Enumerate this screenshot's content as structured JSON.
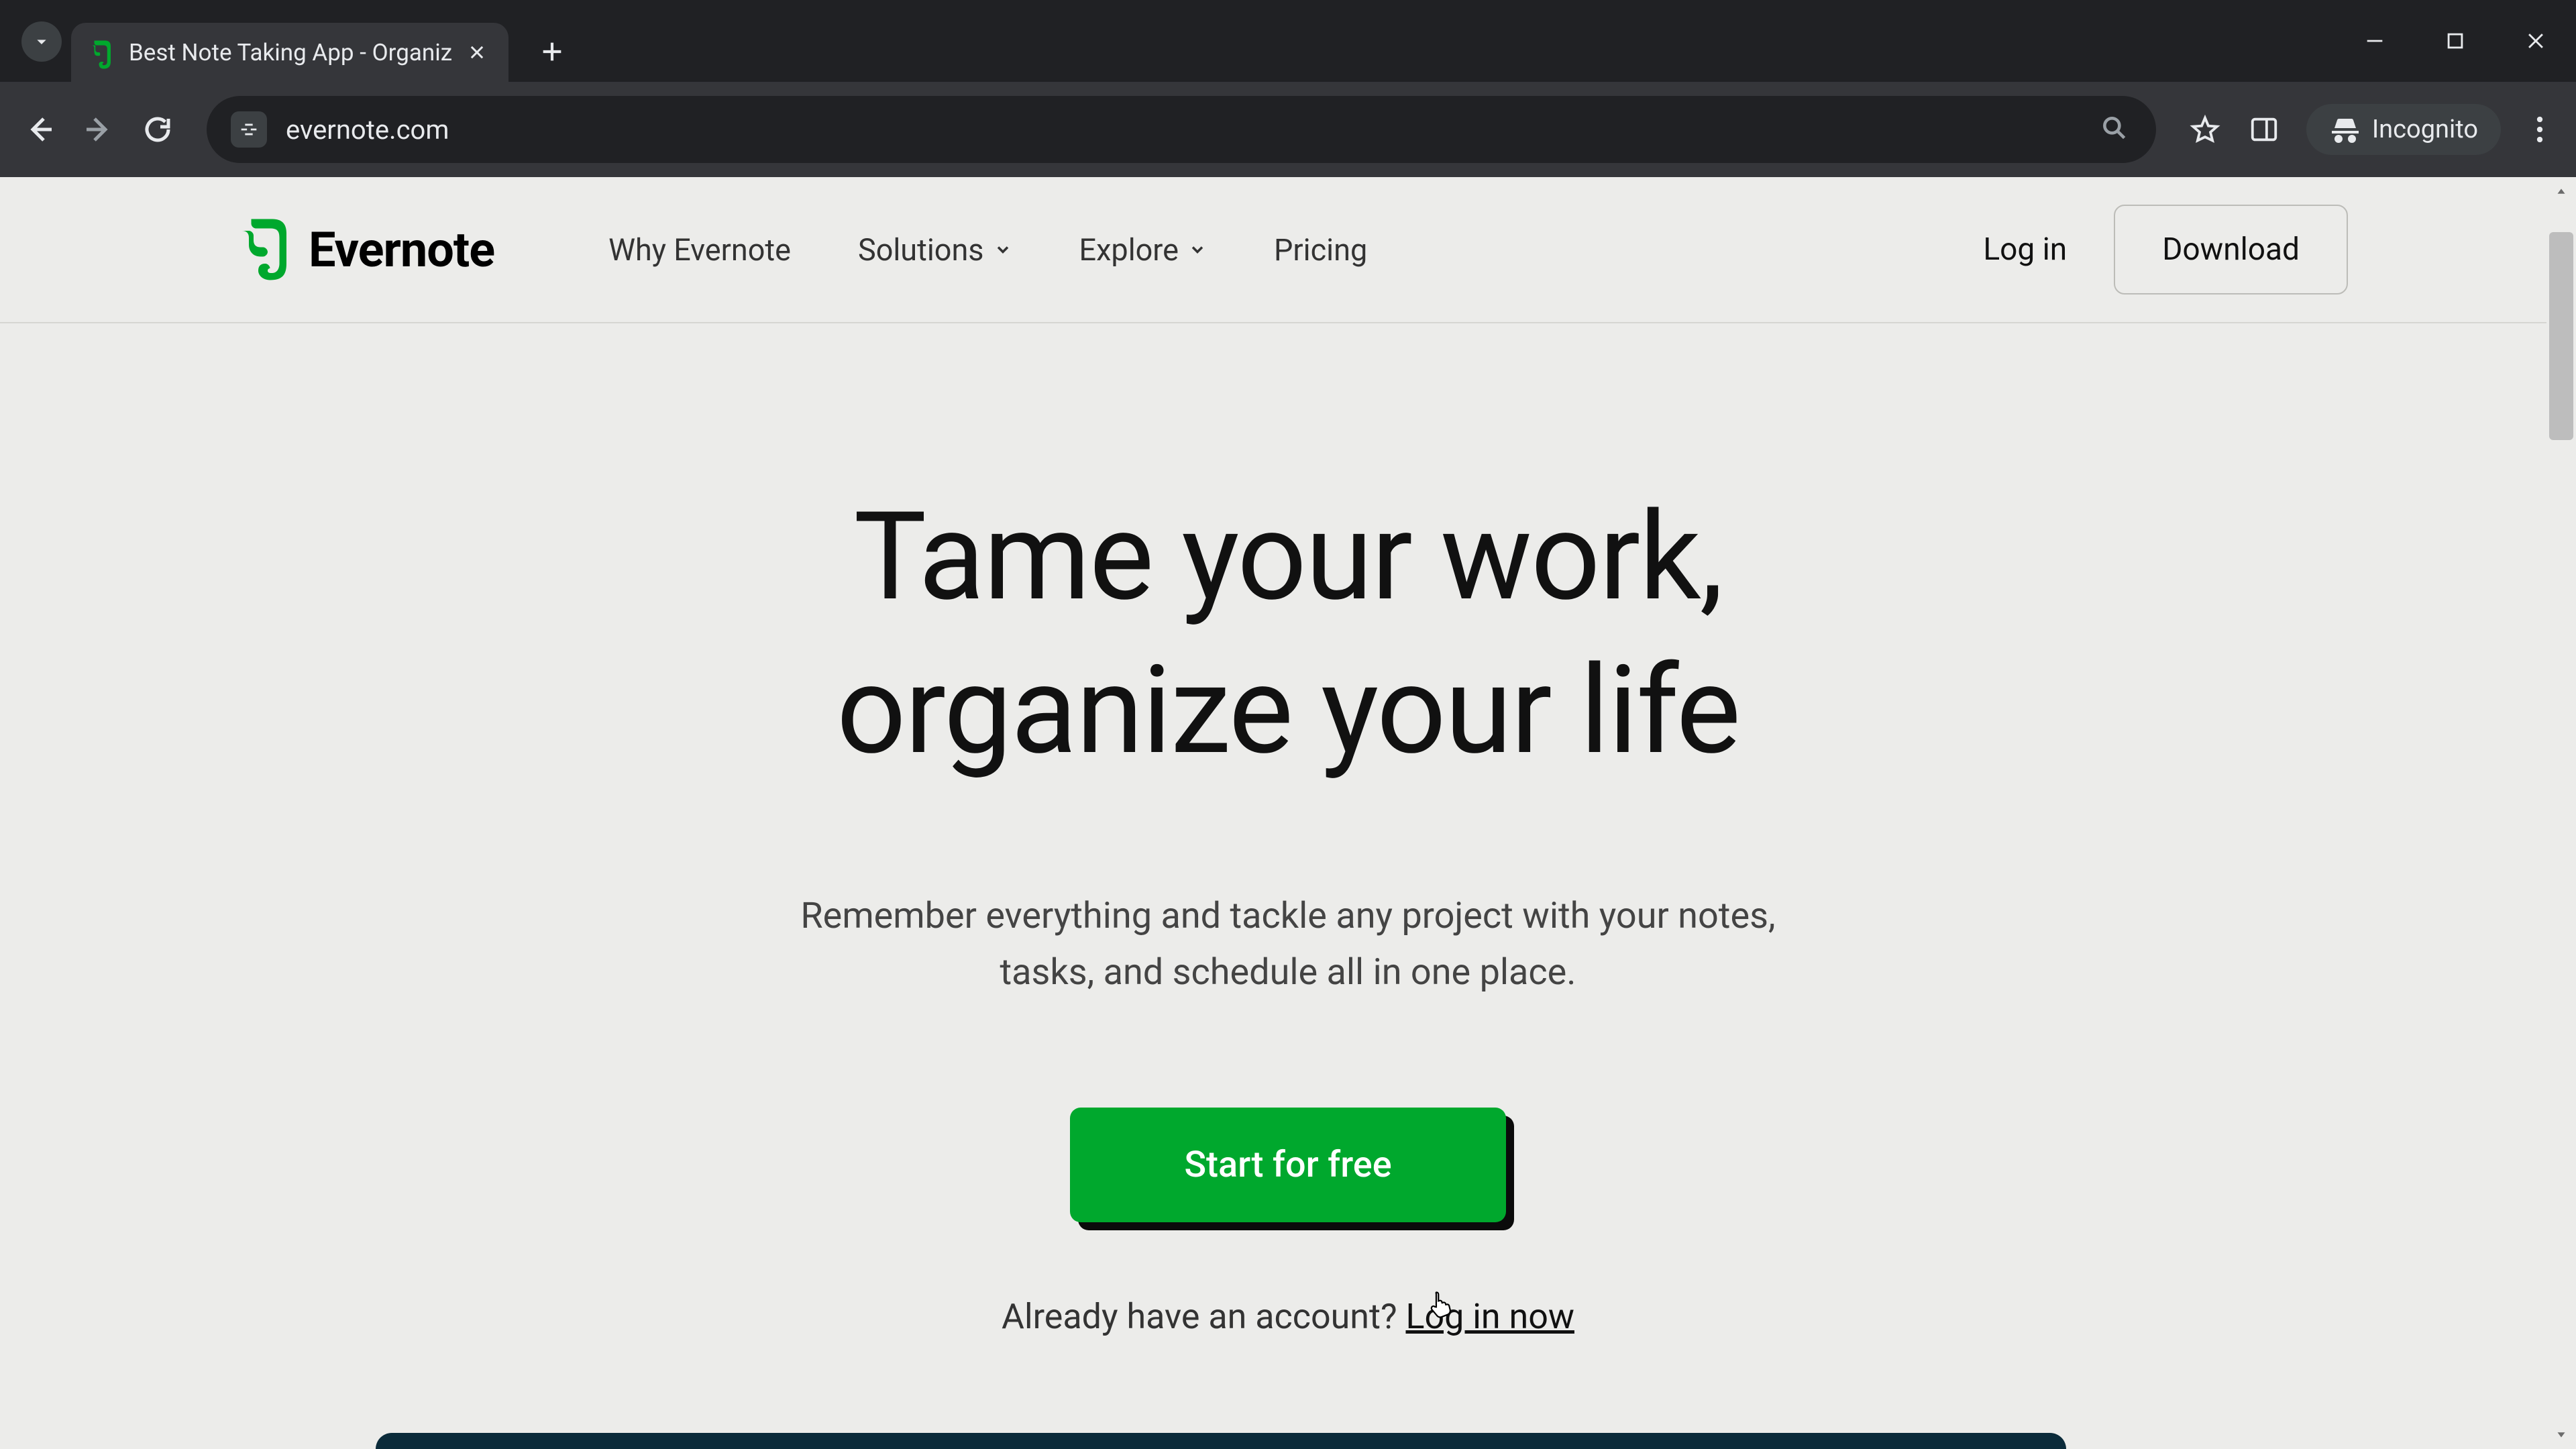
{
  "browser": {
    "tab_title": "Best Note Taking App - Organiz",
    "url": "evernote.com",
    "incognito_label": "Incognito"
  },
  "header": {
    "logo_text": "Evernote",
    "nav": {
      "why": "Why Evernote",
      "solutions": "Solutions",
      "explore": "Explore",
      "pricing": "Pricing"
    },
    "login": "Log in",
    "download": "Download"
  },
  "hero": {
    "line1": "Tame your work,",
    "line2": "organize your life",
    "sub1": "Remember everything and tackle any project with your notes,",
    "sub2": "tasks, and schedule all in one place.",
    "cta": "Start for free",
    "already": "Already have an account? ",
    "login_now": "Log in now"
  },
  "colors": {
    "accent": "#00a82d"
  }
}
